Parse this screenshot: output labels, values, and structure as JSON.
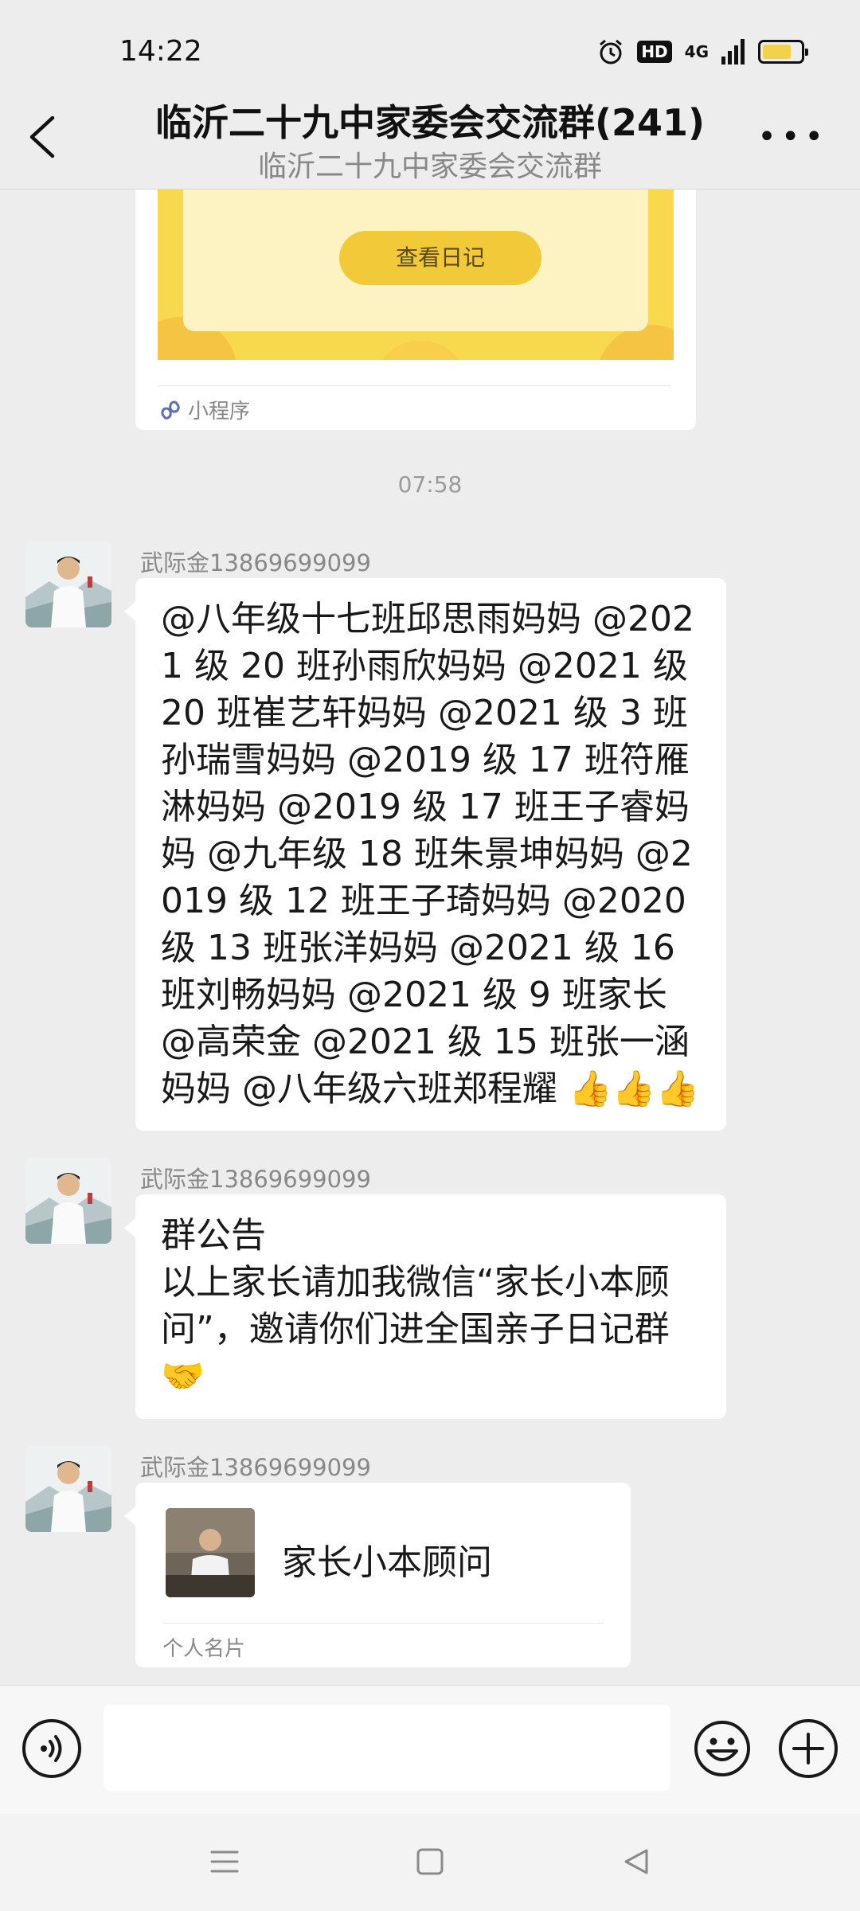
{
  "status_bar": {
    "time": "14:22",
    "hd": "HD",
    "network": "4G",
    "battery_level": 0.75,
    "battery_color": "#f2d24a"
  },
  "nav": {
    "title": "临沂二十九中家委会交流群(241)",
    "subtitle": "临沂二十九中家委会交流群",
    "back_icon": "chevron-left-icon",
    "more_icon": "more-icon"
  },
  "mini_program": {
    "button_label": "查看日记",
    "footer_label": "小程序",
    "footer_icon": "mini-program-icon"
  },
  "timestamp": "07:58",
  "messages": [
    {
      "sender": "武际金13869699099",
      "text": "@八年级十七班邱思雨妈妈 @2021 级 20 班孙雨欣妈妈 @2021 级 20 班崔艺轩妈妈 @2021 级 3 班孙瑞雪妈妈 @2019 级 17 班符雁淋妈妈 @2019 级 17 班王子睿妈妈 @九年级 18 班朱景坤妈妈 @2019 级 12 班王子琦妈妈 @2020 级 13 班张洋妈妈 @2021 级 16 班刘畅妈妈 @2021 级 9 班家长 @高荣金 @2021 级 15 班张一涵妈妈 @八年级六班郑程耀 👍👍👍"
    },
    {
      "sender": "武际金13869699099",
      "text": "群公告\n以上家长请加我微信“家长小本顾问”，邀请你们进全国亲子日记群🤝"
    },
    {
      "sender": "武际金13869699099",
      "card_name": "家长小本顾问",
      "card_label": "个人名片"
    }
  ],
  "input_bar": {
    "voice_icon": "voice-icon",
    "emoji_icon": "emoji-icon",
    "plus_icon": "plus-icon"
  },
  "system_nav": {
    "menu_icon": "menu-icon",
    "home_icon": "home-icon",
    "back_icon": "back-triangle-icon"
  }
}
